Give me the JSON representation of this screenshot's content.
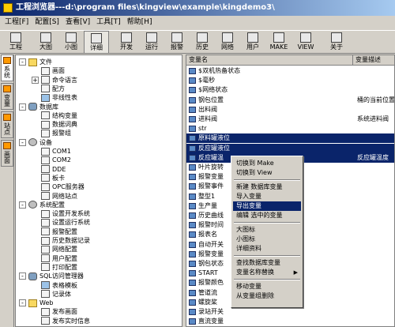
{
  "window": {
    "title": "工程浏览器---d:\\program files\\kingview\\example\\kingdemo3\\"
  },
  "menu": [
    "工程[F]",
    "配置[S]",
    "查看[V]",
    "工具[T]",
    "帮助[H]"
  ],
  "toolbar": {
    "buttons": [
      {
        "label": "工程",
        "icon": "project-icon"
      },
      {
        "label": "大图",
        "icon": "large-icons-icon"
      },
      {
        "label": "小图",
        "icon": "small-icons-icon"
      },
      {
        "label": "详细",
        "icon": "details-icon",
        "active": true
      },
      {
        "label": "开发",
        "icon": "develop-icon"
      },
      {
        "label": "运行",
        "icon": "run-icon"
      },
      {
        "label": "报警",
        "icon": "alarm-icon"
      },
      {
        "label": "历史",
        "icon": "history-icon"
      },
      {
        "label": "网络",
        "icon": "network-icon"
      },
      {
        "label": "用户",
        "icon": "user-icon"
      },
      {
        "label": "MAKE",
        "icon": "make-icon"
      },
      {
        "label": "VIEW",
        "icon": "view-icon"
      },
      {
        "label": "关于",
        "icon": "about-icon"
      }
    ]
  },
  "side_tabs": [
    "系统",
    "变量",
    "站点",
    "画面"
  ],
  "tree": [
    {
      "label": "文件",
      "level": 0,
      "expander": "-",
      "icon": "folder"
    },
    {
      "label": "画面",
      "level": 1,
      "icon": "file"
    },
    {
      "label": "命令语言",
      "level": 1,
      "expander": "+",
      "icon": "file"
    },
    {
      "label": "配方",
      "level": 1,
      "icon": "file"
    },
    {
      "label": "非线性表",
      "level": 1,
      "icon": "table-icon"
    },
    {
      "label": "数据库",
      "level": 0,
      "expander": "-",
      "icon": "db"
    },
    {
      "label": "结构变量",
      "level": 1,
      "icon": "file"
    },
    {
      "label": "数据词典",
      "level": 1,
      "icon": "file"
    },
    {
      "label": "报警组",
      "level": 1,
      "icon": "file"
    },
    {
      "label": "设备",
      "level": 0,
      "expander": "-",
      "icon": "gear"
    },
    {
      "label": "COM1",
      "level": 1,
      "icon": "file"
    },
    {
      "label": "COM2",
      "level": 1,
      "icon": "file"
    },
    {
      "label": "DDE",
      "level": 1,
      "icon": "file"
    },
    {
      "label": "板卡",
      "level": 1,
      "icon": "file"
    },
    {
      "label": "OPC服务器",
      "level": 1,
      "icon": "file"
    },
    {
      "label": "网络站点",
      "level": 1,
      "icon": "file"
    },
    {
      "label": "系统配置",
      "level": 0,
      "expander": "-",
      "icon": "gear"
    },
    {
      "label": "设置开发系统",
      "level": 1,
      "icon": "file"
    },
    {
      "label": "设置运行系统",
      "level": 1,
      "icon": "file"
    },
    {
      "label": "报警配置",
      "level": 1,
      "icon": "file"
    },
    {
      "label": "历史数据记录",
      "level": 1,
      "icon": "file"
    },
    {
      "label": "网络配置",
      "level": 1,
      "icon": "file"
    },
    {
      "label": "用户配置",
      "level": 1,
      "icon": "file"
    },
    {
      "label": "打印配置",
      "level": 1,
      "icon": "file"
    },
    {
      "label": "SQL访问管理器",
      "level": 0,
      "expander": "-",
      "icon": "db"
    },
    {
      "label": "表格模板",
      "level": 1,
      "icon": "table-icon"
    },
    {
      "label": "记录体",
      "level": 1,
      "icon": "file"
    },
    {
      "label": "Web",
      "level": 0,
      "expander": "-",
      "icon": "folder"
    },
    {
      "label": "发布画面",
      "level": 1,
      "icon": "file"
    },
    {
      "label": "发布实时信息",
      "level": 1,
      "icon": "file"
    }
  ],
  "list": {
    "columns": [
      "变量名",
      "变量描述"
    ],
    "rows": [
      {
        "name": "$双机热备状态",
        "desc": ""
      },
      {
        "name": "$毫秒",
        "desc": ""
      },
      {
        "name": "$网络状态",
        "desc": ""
      },
      {
        "name": "钢包位置",
        "desc": "桶的当前位置"
      },
      {
        "name": "出料阀",
        "desc": ""
      },
      {
        "name": "进料阀",
        "desc": "系统进料阀"
      },
      {
        "name": "str",
        "desc": ""
      },
      {
        "name": "原料罐液位",
        "desc": "",
        "selected": true
      },
      {
        "name": "反应罐液位",
        "desc": "",
        "selected": true
      },
      {
        "name": "反应罐温",
        "desc": "反应罐温度",
        "selected": true
      },
      {
        "name": "叶片旋转",
        "desc": ""
      },
      {
        "name": "报警变量",
        "desc": ""
      },
      {
        "name": "报警事件",
        "desc": ""
      },
      {
        "name": "整型1",
        "desc": ""
      },
      {
        "name": "生产量",
        "desc": ""
      },
      {
        "name": "历史曲线",
        "desc": ""
      },
      {
        "name": "报警时间",
        "desc": ""
      },
      {
        "name": "报表名",
        "desc": ""
      },
      {
        "name": "自动开关",
        "desc": ""
      },
      {
        "name": "报警变量",
        "desc": ""
      },
      {
        "name": "钢包状态",
        "desc": ""
      },
      {
        "name": "START",
        "desc": ""
      },
      {
        "name": "报警颜色",
        "desc": ""
      },
      {
        "name": "管道流",
        "desc": ""
      },
      {
        "name": "螺旋桨",
        "desc": ""
      },
      {
        "name": "录站开关",
        "desc": ""
      },
      {
        "name": "直流变量",
        "desc": ""
      }
    ]
  },
  "context_menu": [
    {
      "label": "切换到 Make"
    },
    {
      "label": "切换到 View"
    },
    {
      "sep": true
    },
    {
      "label": "新建 数据库变量"
    },
    {
      "label": "导入变量"
    },
    {
      "label": "导出变量",
      "selected": true
    },
    {
      "label": "编辑 选中的变量"
    },
    {
      "sep": true
    },
    {
      "label": "大图标"
    },
    {
      "label": "小图标"
    },
    {
      "label": "详细资料"
    },
    {
      "sep": true
    },
    {
      "label": "查找数据库变量"
    },
    {
      "label": "变量名称替换",
      "submenu": true
    },
    {
      "sep": true
    },
    {
      "label": "移动变量"
    },
    {
      "label": "从变量组删除"
    }
  ]
}
